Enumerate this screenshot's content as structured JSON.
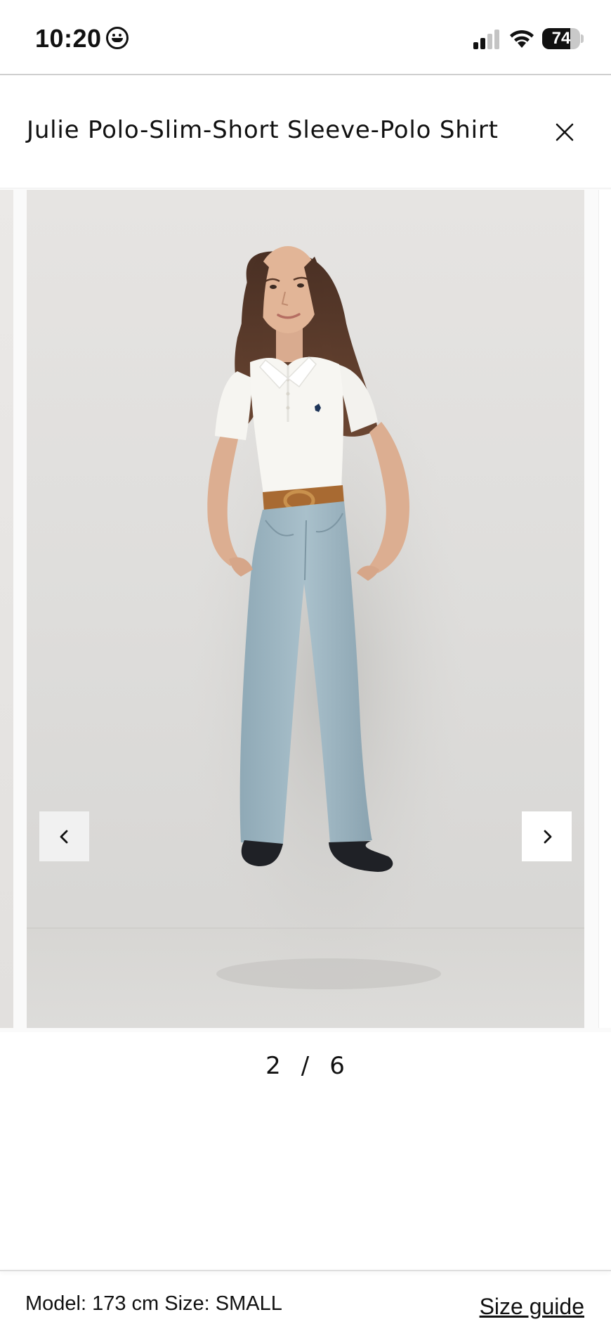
{
  "status_bar": {
    "time": "10:20",
    "battery_level": "74",
    "battery_fraction": 0.74
  },
  "header": {
    "title": "Julie Polo-Slim-Short Sleeve-Polo Shirt"
  },
  "gallery": {
    "current": "2",
    "separator": "/",
    "total": "6"
  },
  "footer": {
    "model_info": "Model: 173 cm Size: SMALL",
    "size_guide_label": "Size guide"
  },
  "icons": {
    "close": "close-icon",
    "prev": "chevron-left-icon",
    "next": "chevron-right-icon",
    "status_emoji": "smiley-icon",
    "signal": "cellular-signal-icon",
    "wifi": "wifi-icon",
    "battery": "battery-icon"
  },
  "colors": {
    "text": "#111111",
    "background": "#ffffff",
    "photo_backdrop": "#e3e1df",
    "shirt": "#f7f6f2",
    "jeans": "#9fb8c4",
    "belt": "#a86a32"
  }
}
